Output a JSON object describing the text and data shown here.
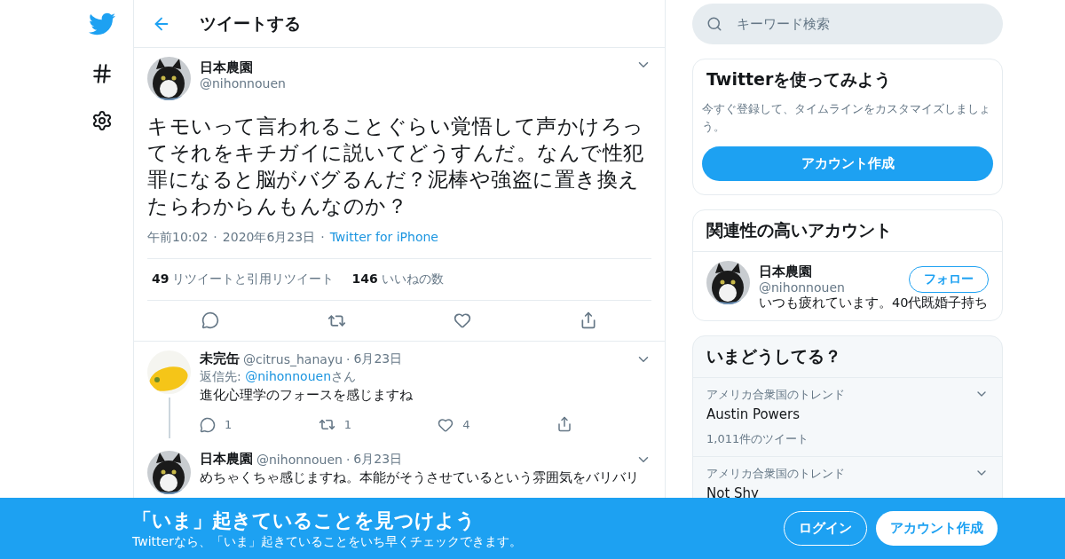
{
  "header": {
    "title": "ツイートする"
  },
  "tweet": {
    "name": "日本農園",
    "handle": "@nihonnouen",
    "text": "キモいって言われることぐらい覚悟して声かけろってそれをキチガイに説いてどうすんだ。なんで性犯罪になると脳がバグるんだ？泥棒や強盗に置き換えたらわからんもんなのか？",
    "meta": [
      {
        "kind": "text",
        "text": "午前10:02"
      },
      {
        "kind": "dot",
        "text": "·"
      },
      {
        "kind": "text",
        "text": "2020年6月23日"
      },
      {
        "kind": "dot",
        "text": "·"
      },
      {
        "kind": "link",
        "text": "Twitter for iPhone"
      }
    ],
    "stats": [
      {
        "count": "49",
        "label": "リツイートと引用リツイート"
      },
      {
        "count": "146",
        "label": "いいねの数"
      }
    ]
  },
  "replies": [
    {
      "name": "未完缶",
      "handle": "@citrus_hanayu",
      "separator": "·",
      "date": "6月23日",
      "reply_label": "返信先: ",
      "reply_handle": "@nihonnouen",
      "reply_suffix": "さん",
      "text": "進化心理学のフォースを感じますね",
      "counts": {
        "reply": "1",
        "retweet": "1",
        "like": "4"
      }
    },
    {
      "name": "日本農園",
      "handle": "@nihonnouen",
      "separator": "·",
      "date": "6月23日",
      "text": "めちゃくちゃ感じますね。本能がそうさせているという雰囲気をバリバリ"
    }
  ],
  "sidebar": {
    "search": {
      "placeholder": "キーワード検索"
    },
    "signup": {
      "title": "Twitterを使ってみよう",
      "text": "今すぐ登録して、タイムラインをカスタマイズしましょう。",
      "button": "アカウント作成"
    },
    "related": {
      "title": "関連性の高いアカウント",
      "accounts": [
        {
          "name": "日本農園",
          "handle": "@nihonnouen",
          "bio": "いつも疲れています。40代既婚子持ち",
          "button": "フォロー"
        }
      ]
    },
    "trends": {
      "title": "いまどうしてる？",
      "items": [
        {
          "context": "アメリカ合衆国のトレンド",
          "name": "Austin Powers",
          "count": "1,011件のツイート"
        },
        {
          "context": "アメリカ合衆国のトレンド",
          "name": "Not Shy"
        }
      ]
    }
  },
  "banner": {
    "title": "「いま」起きていることを見つけよう",
    "text": "Twitterなら、「いま」起きていることをいち早くチェックできます。",
    "login": "ログイン",
    "signup": "アカウント作成"
  }
}
